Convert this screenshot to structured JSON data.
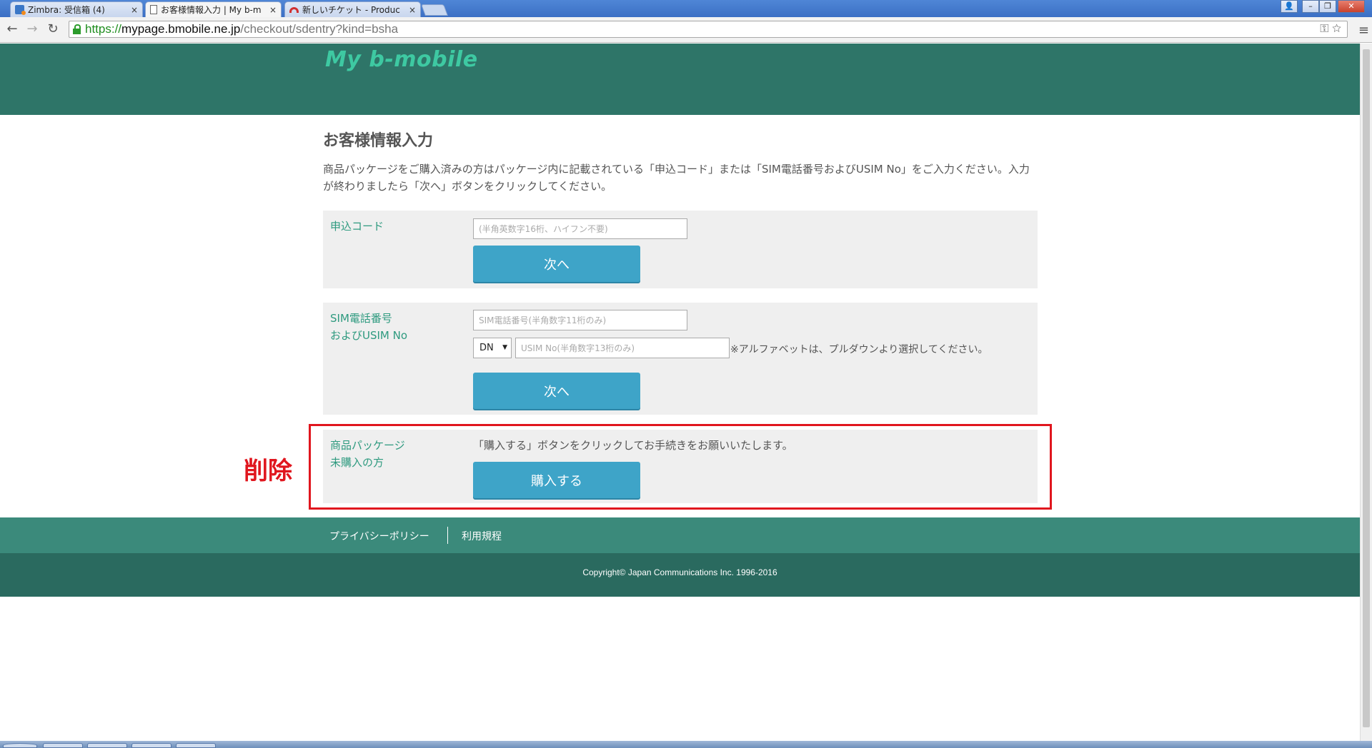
{
  "browser": {
    "tabs": [
      {
        "label": "Zimbra: 受信箱 (4)",
        "icon": "zimbra-favicon"
      },
      {
        "label": "お客様情報入力 | My b-m",
        "icon": "document-favicon"
      },
      {
        "label": "新しいチケット - Produc",
        "icon": "arc-favicon"
      }
    ],
    "close_glyph": "×",
    "url_scheme": "https://",
    "url_host": "mypage.bmobile.ne.jp",
    "url_path": "/checkout/sdentry?kind=bsha",
    "key_icon": "⚿",
    "star_icon": "☆",
    "menu_icon": "≡",
    "back_icon": "←",
    "forward_icon": "→",
    "reload_icon": "↻",
    "win_user": "👤",
    "win_min": "–",
    "win_max": "❐",
    "win_close": "✕"
  },
  "header": {
    "logo": "My b-mobile",
    "brand_color": "#2e7568"
  },
  "main": {
    "title": "お客様情報入力",
    "intro": "商品パッケージをご購入済みの方はパッケージ内に記載されている「申込コード」または「SIM電話番号およびUSIM No」をご入力ください。入力が終わりましたら「次へ」ボタンをクリックしてください。",
    "apply_code": {
      "label": "申込コード",
      "placeholder": "(半角英数字16桁、ハイフン不要)",
      "button": "次へ"
    },
    "sim": {
      "label_line1": "SIM電話番号",
      "label_line2": "およびUSIM No",
      "phone_placeholder": "SIM電話番号(半角数字11桁のみ)",
      "select_value": "DN",
      "select_caret": "▼",
      "usim_placeholder": "USIM No(半角数字13桁のみ)",
      "note": "※アルファベットは、プルダウンより選択してください。",
      "button": "次へ"
    },
    "purchase": {
      "label_line1": "商品パッケージ",
      "label_line2": "未購入の方",
      "message": "「購入する」ボタンをクリックしてお手続きをお願いいたします。",
      "button": "購入する"
    },
    "annotation": "削除",
    "accent_color": "#3ea4c8",
    "annotation_color": "#e0161e"
  },
  "footer": {
    "privacy": "プライバシーポリシー",
    "terms": "利用規程",
    "copyright": "Copyright© Japan Communications Inc. 1996-2016"
  }
}
